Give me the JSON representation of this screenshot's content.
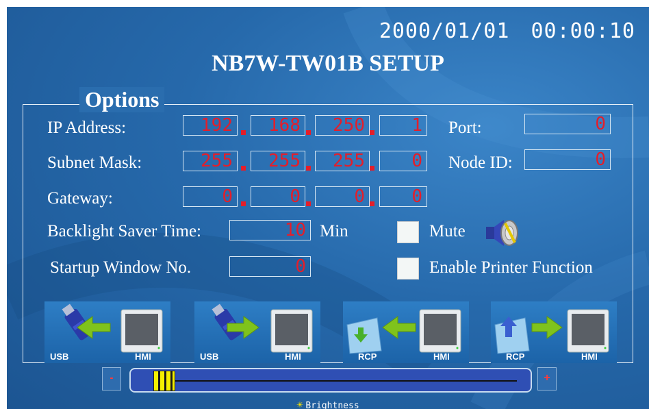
{
  "header": {
    "date": "2000/01/01",
    "time": "00:00:10",
    "title": "NB7W-TW01B SETUP"
  },
  "options": {
    "legend": "Options",
    "ip_address": {
      "label": "IP Address:",
      "octets": [
        "192",
        "168",
        "250",
        "1"
      ]
    },
    "port": {
      "label": "Port:",
      "value": "0"
    },
    "subnet_mask": {
      "label": "Subnet Mask:",
      "octets": [
        "255",
        "255",
        "255",
        "0"
      ]
    },
    "node_id": {
      "label": "Node ID:",
      "value": "0"
    },
    "gateway": {
      "label": "Gateway:",
      "octets": [
        "0",
        "0",
        "0",
        "0"
      ]
    },
    "backlight": {
      "label": "Backlight Saver Time:",
      "value": "10",
      "unit": "Min"
    },
    "startup_window": {
      "label": "Startup Window No.",
      "value": "0"
    },
    "mute": {
      "label": "Mute",
      "checked": false,
      "icon": "speaker-icon"
    },
    "printer": {
      "label": "Enable Printer Function",
      "checked": false
    }
  },
  "transfer_buttons": [
    {
      "left_label": "USB",
      "right_label": "HMI",
      "direction": "hmi-to-usb"
    },
    {
      "left_label": "USB",
      "right_label": "HMI",
      "direction": "usb-to-hmi"
    },
    {
      "left_label": "RCP",
      "right_label": "HMI",
      "direction": "hmi-to-rcp"
    },
    {
      "left_label": "RCP",
      "right_label": "HMI",
      "direction": "rcp-to-hmi"
    }
  ],
  "brightness": {
    "label": "Brightness",
    "decrease_label": "-",
    "increase_label": "+",
    "level": 0.05
  },
  "colors": {
    "background": "#2669ab",
    "value_text": "#e41e2a",
    "arrow": "#7fc31c",
    "slider_thumb": "#f4f000"
  }
}
